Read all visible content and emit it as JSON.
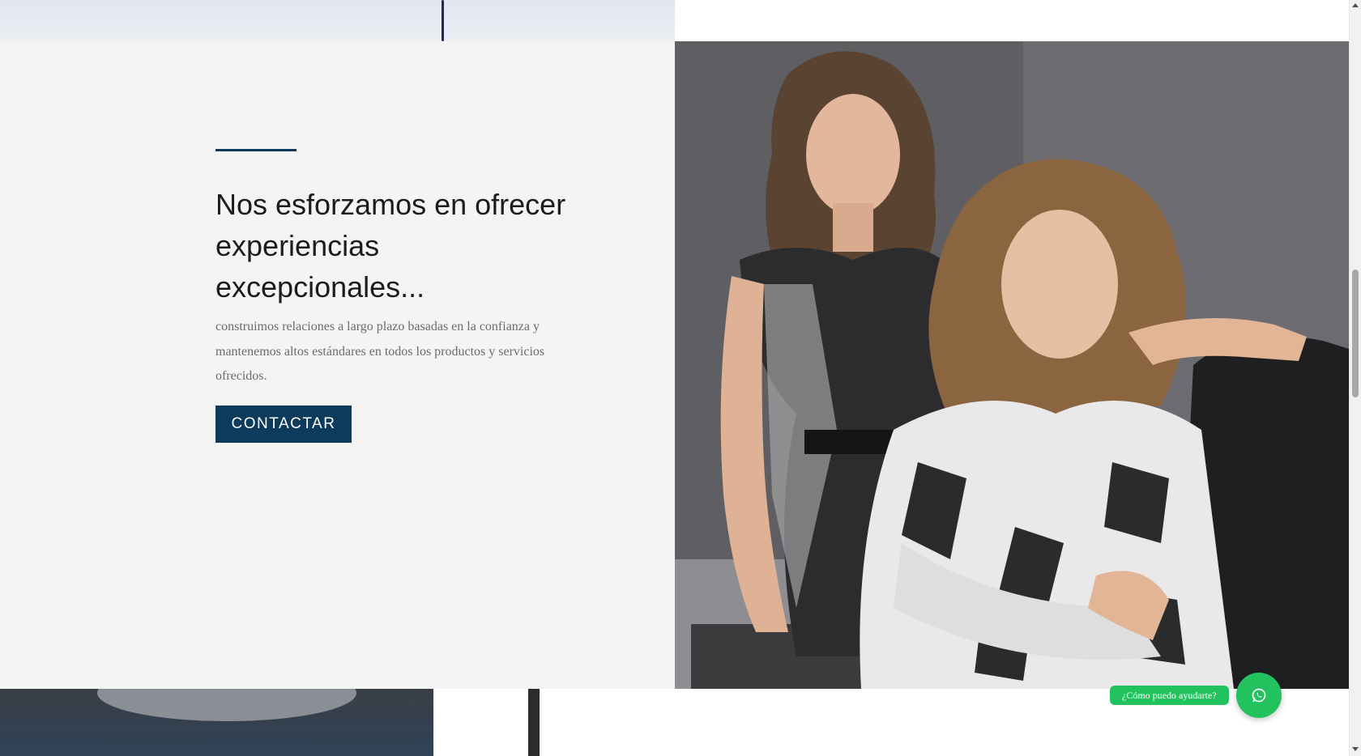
{
  "hero": {
    "headline": "Nos esforzamos en ofrecer experiencias excepcionales...",
    "body": "construimos relaciones a largo plazo basadas en la confianza y mantenemos altos estándares en todos los productos y servicios ofrecidos.",
    "cta_label": "CONTACTAR"
  },
  "whatsapp": {
    "label": "¿Cómo puedo ayudarte?",
    "icon": "whatsapp-icon"
  },
  "colors": {
    "accent": "#0d3b5c",
    "panel_bg": "#f4f4f4",
    "whatsapp_green": "#22c35e"
  },
  "scrollbar": {
    "position_fraction": 0.36
  }
}
